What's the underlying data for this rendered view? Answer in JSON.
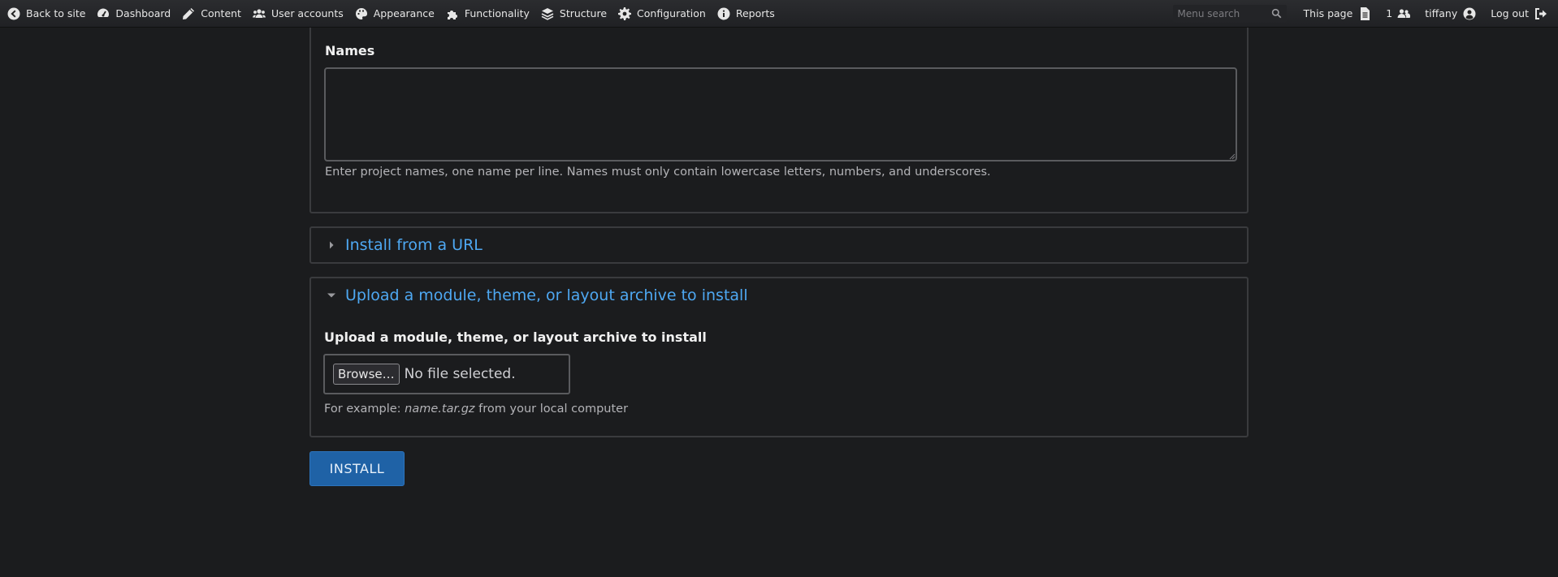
{
  "toolbar": {
    "items": [
      {
        "label": "Back to site",
        "icon": "back-circle-icon"
      },
      {
        "label": "Dashboard",
        "icon": "dashboard-icon"
      },
      {
        "label": "Content",
        "icon": "pencil-icon"
      },
      {
        "label": "User accounts",
        "icon": "users-icon"
      },
      {
        "label": "Appearance",
        "icon": "palette-icon"
      },
      {
        "label": "Functionality",
        "icon": "puzzle-icon"
      },
      {
        "label": "Structure",
        "icon": "layers-icon"
      },
      {
        "label": "Configuration",
        "icon": "gear-icon"
      },
      {
        "label": "Reports",
        "icon": "info-icon"
      }
    ],
    "search": {
      "placeholder": "Menu search",
      "value": ""
    },
    "this_page": "This page",
    "user_count": "1",
    "username": "tiffany",
    "logout": "Log out"
  },
  "form": {
    "names": {
      "label": "Names",
      "value": "",
      "description": "Enter project names, one name per line. Names must only contain lowercase letters, numbers, and underscores."
    },
    "install_from_url": {
      "summary": "Install from a URL",
      "expanded": false
    },
    "upload": {
      "summary": "Upload a module, theme, or layout archive to install",
      "expanded": true,
      "label": "Upload a module, theme, or layout archive to install",
      "browse_label": "Browse…",
      "file_status": "No file selected.",
      "desc_prefix": "For example: ",
      "desc_example": "name.tar.gz",
      "desc_suffix": " from your local computer"
    },
    "submit_label": "INSTALL"
  },
  "colors": {
    "background": "#1b1c1e",
    "link": "#4ea8f2",
    "primary_button": "#1f62a6"
  }
}
